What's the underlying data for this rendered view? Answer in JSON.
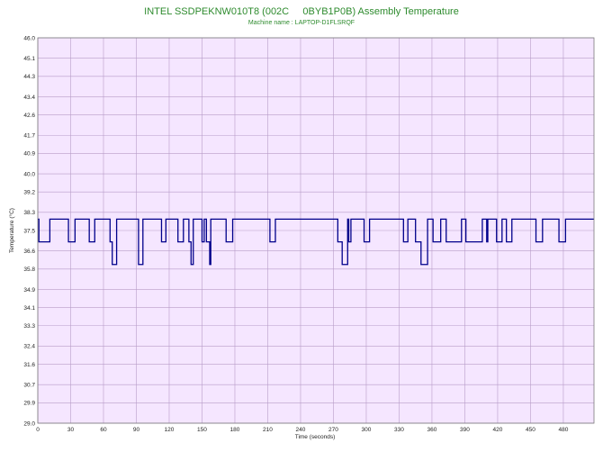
{
  "chart_data": {
    "type": "line",
    "title": "INTEL SSDPEKNW010T8 (002C     0BYB1P0B) Assembly Temperature",
    "subtitle": "Machine name : LAPTOP-D1FLSRQF",
    "xlabel": "Time (seconds)",
    "ylabel": "Temperature (°C)",
    "xlim": [
      0,
      508
    ],
    "ylim": [
      29.0,
      46.0
    ],
    "x_ticks": [
      0,
      30,
      60,
      90,
      120,
      150,
      180,
      210,
      240,
      270,
      300,
      330,
      360,
      390,
      420,
      450,
      480
    ],
    "y_ticks": [
      "29.0",
      "29.9",
      "30.7",
      "31.6",
      "32.4",
      "33.3",
      "34.1",
      "34.9",
      "35.8",
      "36.6",
      "37.5",
      "38.3",
      "39.2",
      "40.0",
      "40.9",
      "41.7",
      "42.6",
      "43.4",
      "44.3",
      "45.1",
      "46.0"
    ],
    "grid": true,
    "series": [
      {
        "values_x": [
          0,
          1,
          1,
          11,
          11,
          28,
          28,
          34,
          34,
          47,
          47,
          52,
          52,
          66,
          66,
          68,
          68,
          72,
          72,
          76,
          76,
          92,
          92,
          96,
          96,
          113,
          113,
          117,
          117,
          128,
          128,
          133,
          133,
          138,
          138,
          140,
          140,
          142,
          142,
          150,
          150,
          152,
          152,
          154,
          154,
          157,
          157,
          158,
          158,
          172,
          172,
          178,
          178,
          212,
          212,
          217,
          217,
          274,
          274,
          278,
          278,
          283,
          283,
          284,
          284,
          286,
          286,
          288,
          288,
          298,
          298,
          303,
          303,
          334,
          334,
          338,
          338,
          345,
          345,
          350,
          350,
          356,
          356,
          361,
          361,
          368,
          368,
          373,
          373,
          387,
          387,
          391,
          391,
          406,
          406,
          410,
          410,
          411,
          411,
          419,
          419,
          424,
          424,
          428,
          428,
          433,
          433,
          455,
          455,
          461,
          461,
          476,
          476,
          482,
          482,
          508
        ],
        "values_y": [
          38.0,
          38.0,
          37.0,
          37.0,
          38.0,
          38.0,
          37.0,
          37.0,
          38.0,
          38.0,
          37.0,
          37.0,
          38.0,
          38.0,
          37.0,
          37.0,
          36.0,
          36.0,
          38.0,
          38.0,
          38.0,
          38.0,
          36.0,
          36.0,
          38.0,
          38.0,
          37.0,
          37.0,
          38.0,
          38.0,
          37.0,
          37.0,
          38.0,
          38.0,
          37.0,
          37.0,
          36.0,
          36.0,
          38.0,
          38.0,
          37.0,
          37.0,
          38.0,
          38.0,
          37.0,
          37.0,
          36.0,
          36.0,
          38.0,
          38.0,
          37.0,
          37.0,
          38.0,
          38.0,
          37.0,
          37.0,
          38.0,
          38.0,
          37.0,
          37.0,
          36.0,
          36.0,
          38.0,
          38.0,
          37.0,
          37.0,
          38.0,
          38.0,
          38.0,
          38.0,
          37.0,
          37.0,
          38.0,
          38.0,
          37.0,
          37.0,
          38.0,
          38.0,
          37.0,
          37.0,
          36.0,
          36.0,
          38.0,
          38.0,
          37.0,
          37.0,
          38.0,
          38.0,
          37.0,
          37.0,
          38.0,
          38.0,
          37.0,
          37.0,
          38.0,
          38.0,
          37.0,
          37.0,
          38.0,
          38.0,
          37.0,
          37.0,
          38.0,
          38.0,
          37.0,
          37.0,
          38.0,
          38.0,
          37.0,
          37.0,
          38.0,
          38.0,
          37.0,
          37.0,
          38.0,
          38.0
        ],
        "color": "#00008b"
      }
    ]
  },
  "colors": {
    "title": "#2e8b2e",
    "plot_background": "#f5e6ff",
    "grid": "#b89cc8",
    "line": "#00008b"
  }
}
